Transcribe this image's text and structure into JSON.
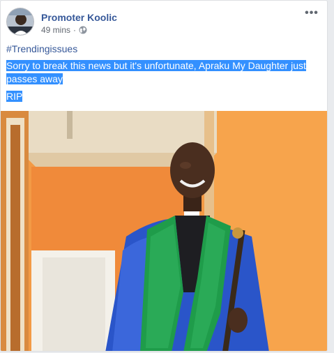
{
  "post": {
    "author": "Promoter Koolic",
    "time": "49 mins",
    "separator": "·",
    "privacy_icon": "globe-icon",
    "more_label": "•••",
    "hashtag": "#Trendingissues",
    "message_line1": "Sorry to break this news but it's unfortunate, Apraku My Daughter just",
    "message_line2": "passes away",
    "message_rip": "RIP"
  },
  "colors": {
    "link": "#365899",
    "selection": "#3390ff",
    "meta": "#616770",
    "orange_wall": "#f59a3e",
    "robe": "#2a55c9",
    "stole": "#1f9c4a"
  }
}
